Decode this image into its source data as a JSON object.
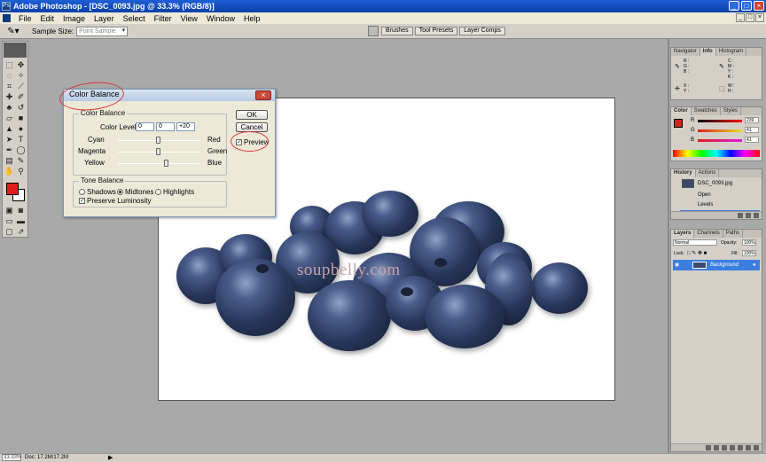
{
  "window": {
    "title": "Adobe Photoshop - [DSC_0093.jpg @ 33.3% (RGB/8)]",
    "buttons": [
      "_",
      "□",
      "×"
    ]
  },
  "menubar": {
    "items": [
      "File",
      "Edit",
      "Image",
      "Layer",
      "Select",
      "Filter",
      "View",
      "Window",
      "Help"
    ],
    "doc_buttons": [
      "_",
      "□",
      "×"
    ]
  },
  "options": {
    "sample_size_label": "Sample Size:",
    "sample_size_value": "Point Sample"
  },
  "palette_well": {
    "tabs": [
      "Brushes",
      "Tool Presets",
      "Layer Comps"
    ]
  },
  "toolbox": {
    "colors": {
      "foreground": "#e01c1c",
      "background": "#ffffff"
    }
  },
  "canvas": {
    "watermark": "soupbelly.com"
  },
  "dialog": {
    "title": "Color Balance",
    "close_glyph": "×",
    "color_balance_group": "Color Balance",
    "color_levels_label": "Color Levels:",
    "levels": [
      "0",
      "0",
      "+20"
    ],
    "sliders": [
      {
        "left": "Cyan",
        "right": "Red",
        "value": 0
      },
      {
        "left": "Magenta",
        "right": "Green",
        "value": 0
      },
      {
        "left": "Yellow",
        "right": "Blue",
        "value": 20
      }
    ],
    "tone_group": "Tone Balance",
    "tones": [
      "Shadows",
      "Midtones",
      "Highlights"
    ],
    "selected_tone": "Midtones",
    "preserve_luminosity": "Preserve Luminosity",
    "preserve_checked": true,
    "ok": "OK",
    "cancel": "Cancel",
    "preview": "Preview",
    "preview_checked": true
  },
  "navigator_panel": {
    "tabs": [
      "Navigator",
      "Info",
      "Histogram"
    ],
    "active": "Info",
    "labels": {
      "rgb": "R :\nG :\nB :",
      "cmyk": "C :\nM :\nY :\nK :",
      "xy": "X :\nY :",
      "wh": "W :\nH :"
    }
  },
  "color_panel": {
    "tabs": [
      "Color",
      "Swatches",
      "Styles"
    ],
    "active": "Color",
    "channels": [
      {
        "label": "R",
        "value": "239"
      },
      {
        "label": "G",
        "value": "41"
      },
      {
        "label": "B",
        "value": "41"
      }
    ]
  },
  "history_panel": {
    "tabs": [
      "History",
      "Actions"
    ],
    "active": "History",
    "snapshot": "DSC_0093.jpg",
    "states": [
      "Open",
      "Levels"
    ]
  },
  "layers_panel": {
    "tabs": [
      "Layers",
      "Channels",
      "Paths"
    ],
    "active": "Layers",
    "blend_mode": "Normal",
    "opacity_label": "Opacity:",
    "opacity": "100%",
    "lock_label": "Lock:",
    "fill_label": "Fill:",
    "fill": "100%",
    "layers": [
      "Background"
    ]
  },
  "statusbar": {
    "zoom": "33.33%",
    "doc": "Doc: 17.2M/17.2M",
    "arrow": "▶"
  }
}
